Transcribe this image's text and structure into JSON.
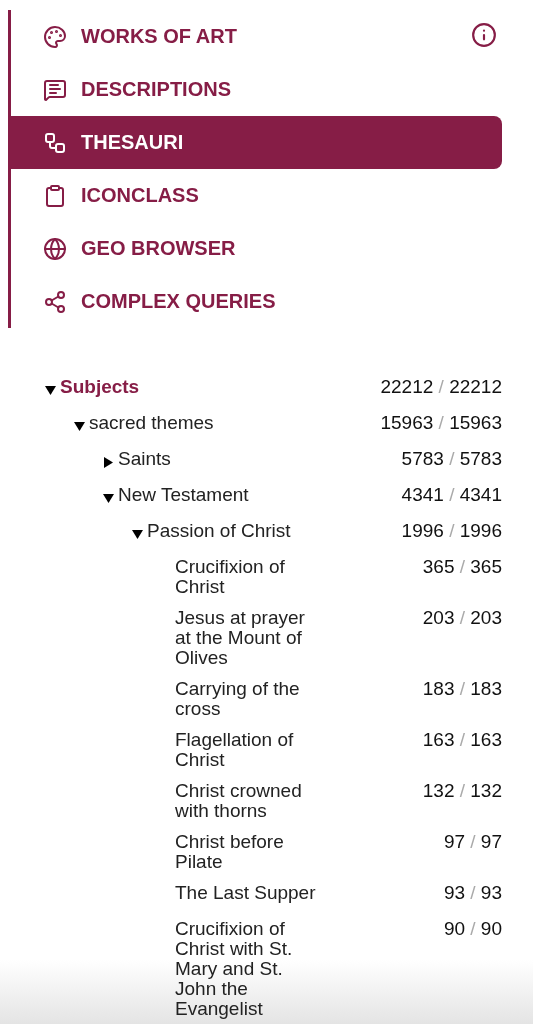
{
  "nav": {
    "items": [
      {
        "label": "WORKS OF ART",
        "selected": false
      },
      {
        "label": "DESCRIPTIONS",
        "selected": false
      },
      {
        "label": "THESAURI",
        "selected": true
      },
      {
        "label": "ICONCLASS",
        "selected": false
      },
      {
        "label": "GEO BROWSER",
        "selected": false
      },
      {
        "label": "COMPLEX QUERIES",
        "selected": false
      }
    ]
  },
  "tree": {
    "nodes": [
      {
        "label": "Subjects",
        "count": "22212",
        "separator": "/",
        "total": "22212",
        "expanded": true,
        "children": [
          {
            "label": "sacred themes",
            "count": "15963",
            "separator": "/",
            "total": "15963",
            "expanded": true,
            "children": [
              {
                "label": "Saints",
                "count": "5783",
                "separator": "/",
                "total": "5783",
                "expanded": false
              },
              {
                "label": "New Testament",
                "count": "4341",
                "separator": "/",
                "total": "4341",
                "expanded": true,
                "children": [
                  {
                    "label": "Passion of Christ",
                    "count": "1996",
                    "separator": "/",
                    "total": "1996",
                    "expanded": true,
                    "children": [
                      {
                        "label": "Crucifixion of Christ",
                        "count": "365",
                        "separator": "/",
                        "total": "365"
                      },
                      {
                        "label": "Jesus at prayer at the Mount of Olives",
                        "count": "203",
                        "separator": "/",
                        "total": "203"
                      },
                      {
                        "label": "Carrying of the cross",
                        "count": "183",
                        "separator": "/",
                        "total": "183"
                      },
                      {
                        "label": "Flagellation of Christ",
                        "count": "163",
                        "separator": "/",
                        "total": "163"
                      },
                      {
                        "label": "Christ crowned with thorns",
                        "count": "132",
                        "separator": "/",
                        "total": "132"
                      },
                      {
                        "label": "Christ before Pilate",
                        "count": "97",
                        "separator": "/",
                        "total": "97"
                      },
                      {
                        "label": "The Last Supper",
                        "count": "93",
                        "separator": "/",
                        "total": "93"
                      },
                      {
                        "label": "Crucifixion of Christ with St. Mary and St. John the Evangelist",
                        "count": "90",
                        "separator": "/",
                        "total": "90"
                      }
                    ]
                  }
                ]
              }
            ]
          }
        ]
      }
    ]
  }
}
